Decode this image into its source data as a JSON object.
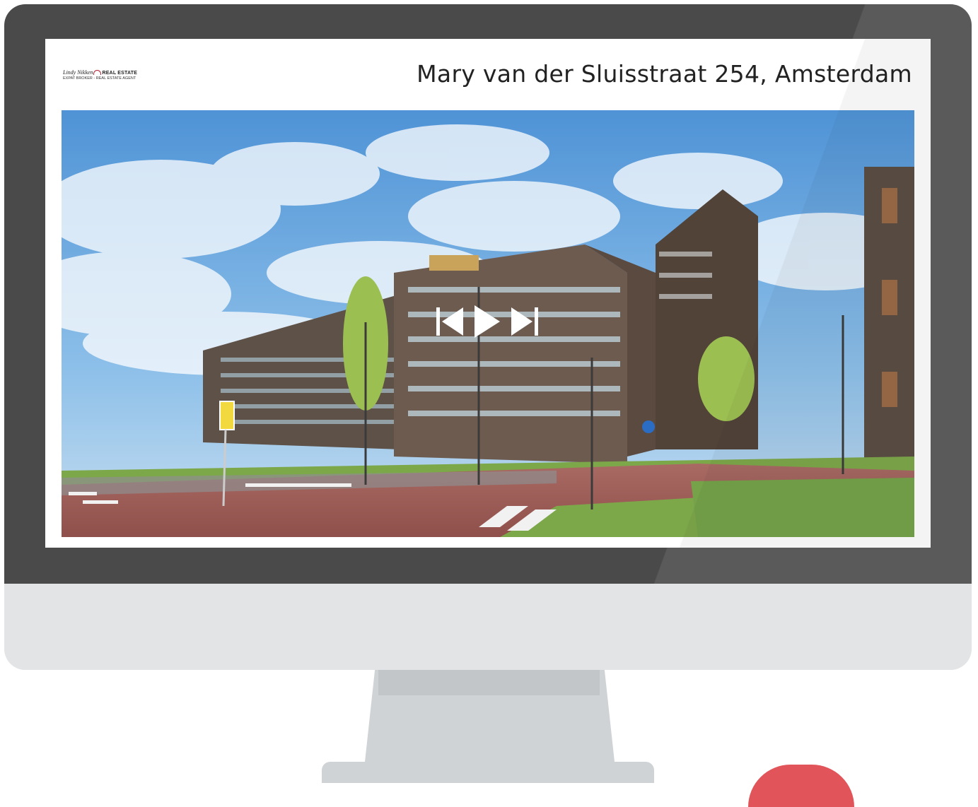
{
  "logo": {
    "name": "Lindy Nikken",
    "brand": "REAL ESTATE",
    "tagline": "EXPAT BROKER - REAL ESTATE AGENT"
  },
  "listing": {
    "address": "Mary van der Sluisstraat 254, Amsterdam"
  },
  "slideshow": {
    "controls": [
      "previous",
      "play",
      "next"
    ],
    "icons": [
      "skip-previous-icon",
      "play-icon",
      "skip-next-icon"
    ]
  },
  "colors": {
    "bezel": "#4a4a4a",
    "chin": "#e3e4e6",
    "stand": "#cfd3d6",
    "accent": "#e0545a",
    "sky": "#6ea9dc",
    "brick": "#6b5a4e",
    "grass": "#7da84a"
  }
}
